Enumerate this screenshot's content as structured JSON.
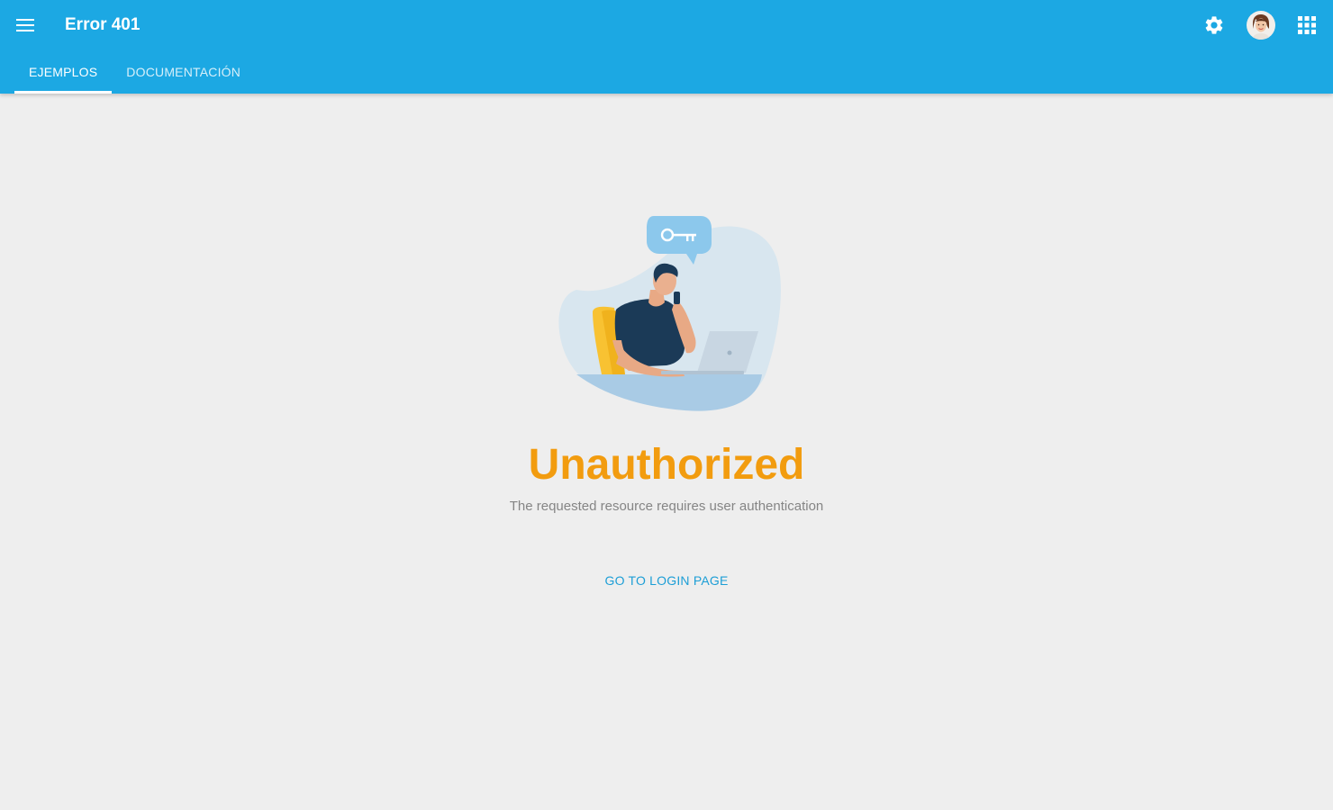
{
  "header": {
    "title": "Error 401",
    "menu_icon": "menu-icon",
    "settings_icon": "gear-icon",
    "apps_icon": "apps-grid-icon"
  },
  "tabs": [
    {
      "label": "EJEMPLOS",
      "active": true
    },
    {
      "label": "DOCUMENTACIÓN",
      "active": false
    }
  ],
  "error": {
    "title": "Unauthorized",
    "message": "The requested resource requires user authentication",
    "action_label": "GO TO LOGIN PAGE"
  },
  "colors": {
    "appbar": "#1ca8e3",
    "background": "#eeeeee",
    "title_accent": "#f29c0f",
    "link": "#1c9ed6"
  }
}
